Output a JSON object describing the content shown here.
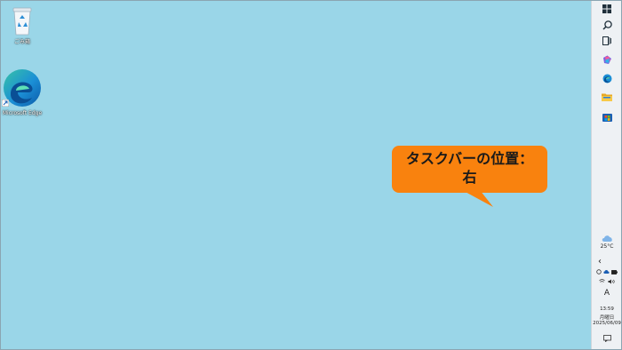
{
  "desktop": {
    "icons": [
      {
        "label": "ごみ箱",
        "icon": "recycle-bin-icon"
      },
      {
        "label": "Microsoft Edge",
        "icon": "edge-icon"
      }
    ]
  },
  "callout": {
    "line1": "タスクバーの位置：",
    "line2": "右",
    "color": "#f9820e"
  },
  "taskbar": {
    "position": "right",
    "pinned": [
      "windows-start-icon",
      "search-icon",
      "task-view-icon",
      "copilot-icon",
      "edge-icon",
      "file-explorer-icon",
      "store-icon"
    ],
    "weather": {
      "temp": "25°C",
      "icon": "cloud-icon"
    },
    "tray_arrow": "‹",
    "ime": "A",
    "clock": {
      "time": "13:59",
      "day": "月曜日",
      "date": "2025/06/09"
    }
  }
}
